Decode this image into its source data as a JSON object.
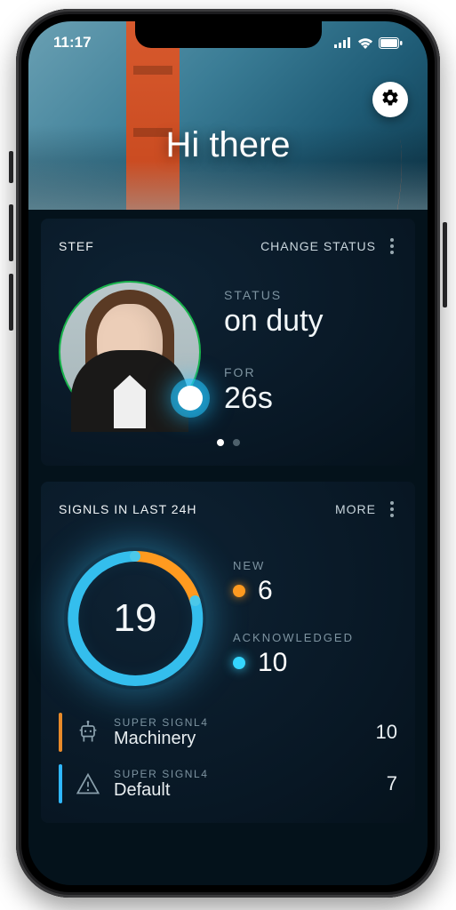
{
  "status_bar": {
    "time": "11:17"
  },
  "header": {
    "greeting": "Hi there"
  },
  "status_card": {
    "user_name": "STEF",
    "change_label": "CHANGE STATUS",
    "status_label": "STATUS",
    "status_value": "on duty",
    "for_label": "FOR",
    "for_value": "26s"
  },
  "signals_card": {
    "title": "SIGNLS IN LAST 24H",
    "more_label": "MORE",
    "total": "19",
    "new_label": "NEW",
    "new_value": "6",
    "ack_label": "ACKNOWLEDGED",
    "ack_value": "10",
    "items": [
      {
        "sub": "SUPER SIGNL4",
        "title": "Machinery",
        "count": "10",
        "accent": "orange",
        "icon": "robot"
      },
      {
        "sub": "SUPER SIGNL4",
        "title": "Default",
        "count": "7",
        "accent": "cyan",
        "icon": "warning"
      }
    ]
  },
  "colors": {
    "orange": "#ff9a1f",
    "cyan": "#35d6ff",
    "ring_green": "#19b24c"
  }
}
